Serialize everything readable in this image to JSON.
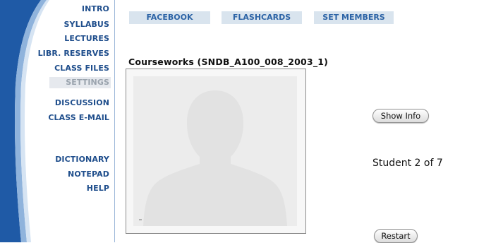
{
  "sidebar": {
    "items": [
      {
        "label": "INTRO"
      },
      {
        "label": "SYLLABUS"
      },
      {
        "label": "LECTURES"
      },
      {
        "label": "LIBR. RESERVES"
      },
      {
        "label": "CLASS FILES"
      },
      {
        "label": "SETTINGS",
        "active": true
      },
      {
        "label": "DISCUSSION"
      },
      {
        "label": "CLASS E-MAIL"
      },
      {
        "label": "DICTIONARY"
      },
      {
        "label": "NOTEPAD"
      },
      {
        "label": "HELP"
      }
    ]
  },
  "tabs": [
    {
      "label": "FACEBOOK"
    },
    {
      "label": "FLASHCARDS"
    },
    {
      "label": "SET MEMBERS"
    }
  ],
  "main": {
    "title": "Courseworks (SNDB_A100_008_2003_1)",
    "show_info_label": "Show Info",
    "student_counter": "Student 2 of 7",
    "restart_label": "Restart"
  },
  "icons": {
    "photo": "person-silhouette-icon"
  },
  "colors": {
    "nav_text": "#1f4e8c",
    "tab_bg": "#d9e4ee",
    "tab_text": "#2d64a6",
    "swoosh_blue": "#1f5aa6",
    "active_nav_bg": "#e6e9ee"
  }
}
